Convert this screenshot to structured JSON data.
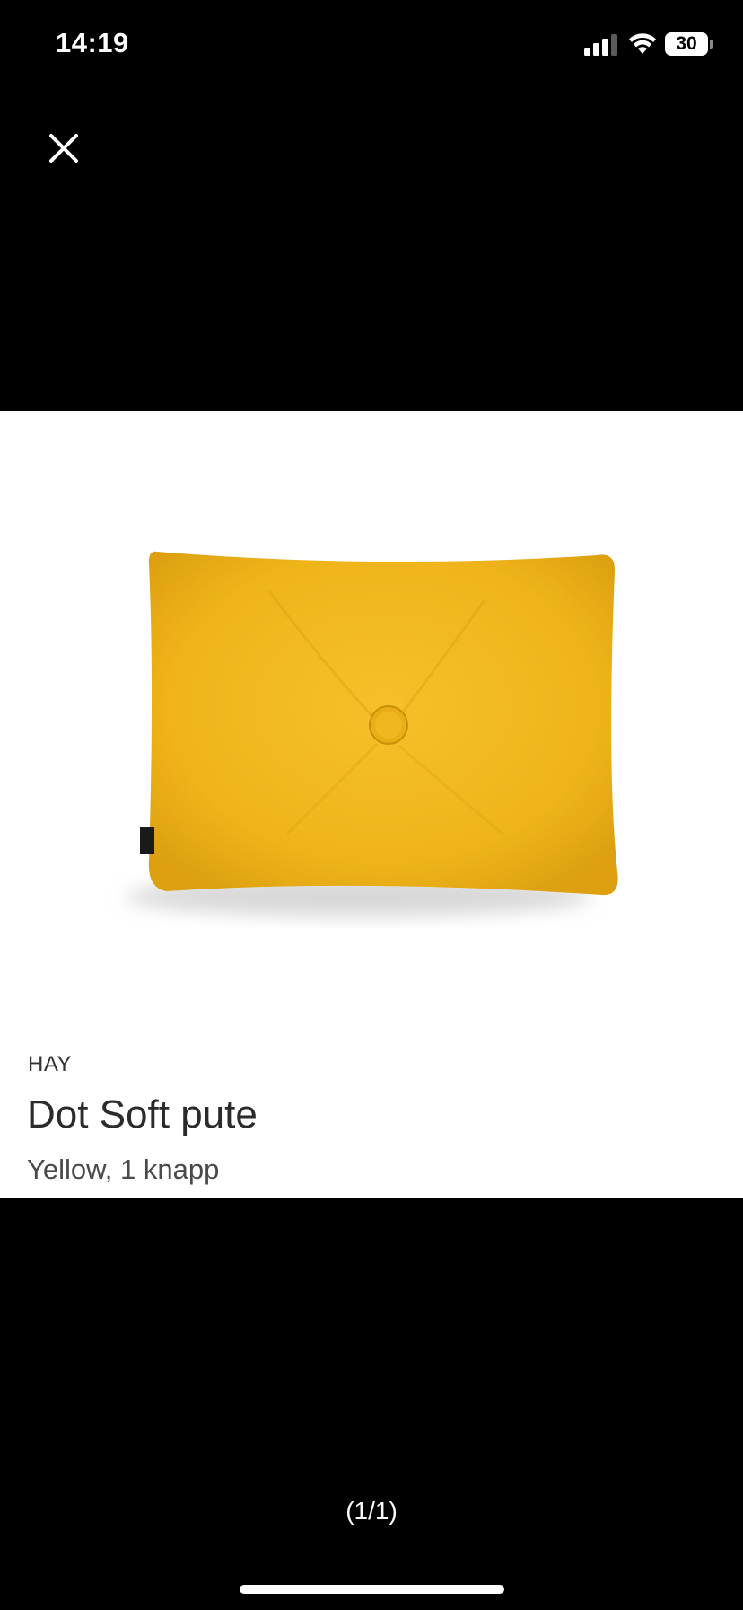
{
  "status_bar": {
    "time": "14:19",
    "battery_level": "30",
    "signal_icon": "cellular-signal-icon",
    "wifi_icon": "wifi-icon"
  },
  "viewer": {
    "close_icon": "close-icon",
    "page_counter": "(1/1)"
  },
  "product": {
    "brand": "HAY",
    "name": "Dot Soft pute",
    "variant": "Yellow, 1 knapp",
    "image": "yellow-cushion-image",
    "colors": {
      "cushion": "#f2b81c",
      "cushion_shadow": "#d99e0e"
    }
  },
  "colors": {
    "background": "#000000",
    "card": "#ffffff",
    "text_primary": "#2b2b2b"
  }
}
